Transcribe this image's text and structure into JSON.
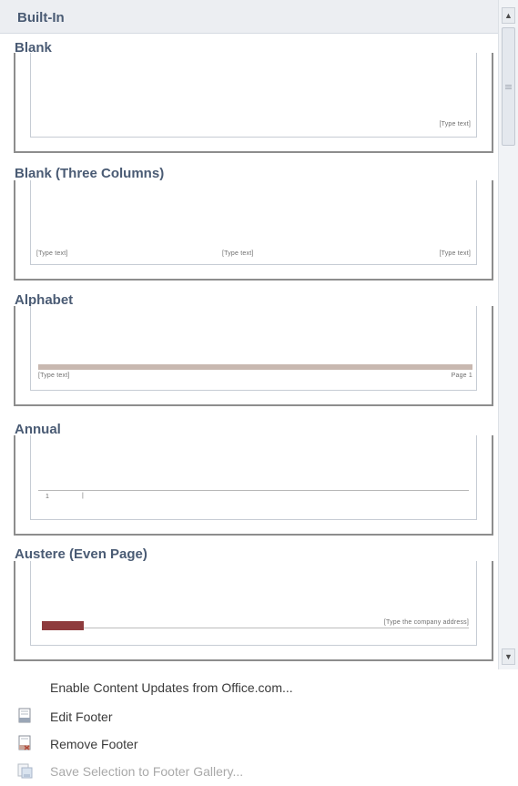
{
  "gallery": {
    "section_header": "Built-In",
    "items": [
      {
        "label": "Blank",
        "fields": [
          "[Type text]"
        ]
      },
      {
        "label": "Blank (Three Columns)",
        "fields": [
          "[Type text]",
          "[Type text]",
          "[Type text]"
        ]
      },
      {
        "label": "Alphabet",
        "fields": [
          "[Type text]",
          "Page 1"
        ]
      },
      {
        "label": "Annual",
        "fields": [
          "1",
          "|"
        ]
      },
      {
        "label": "Austere (Even Page)",
        "fields": [
          "[Type the company address]"
        ]
      }
    ],
    "colors": {
      "accent_red": "#8e3b3d",
      "alphabet_band": "#c8b8b0"
    }
  },
  "scrollbar": {
    "up_icon": "arrow-up-icon",
    "down_icon": "arrow-down-icon"
  },
  "menu": {
    "items": [
      {
        "label": "Enable Content Updates from Office.com...",
        "icon": "",
        "enabled": true
      },
      {
        "label": "Edit Footer",
        "icon": "edit-footer-icon",
        "enabled": true
      },
      {
        "label": "Remove Footer",
        "icon": "remove-footer-icon",
        "enabled": true
      },
      {
        "label": "Save Selection to Footer Gallery...",
        "icon": "save-selection-icon",
        "enabled": false
      }
    ]
  }
}
